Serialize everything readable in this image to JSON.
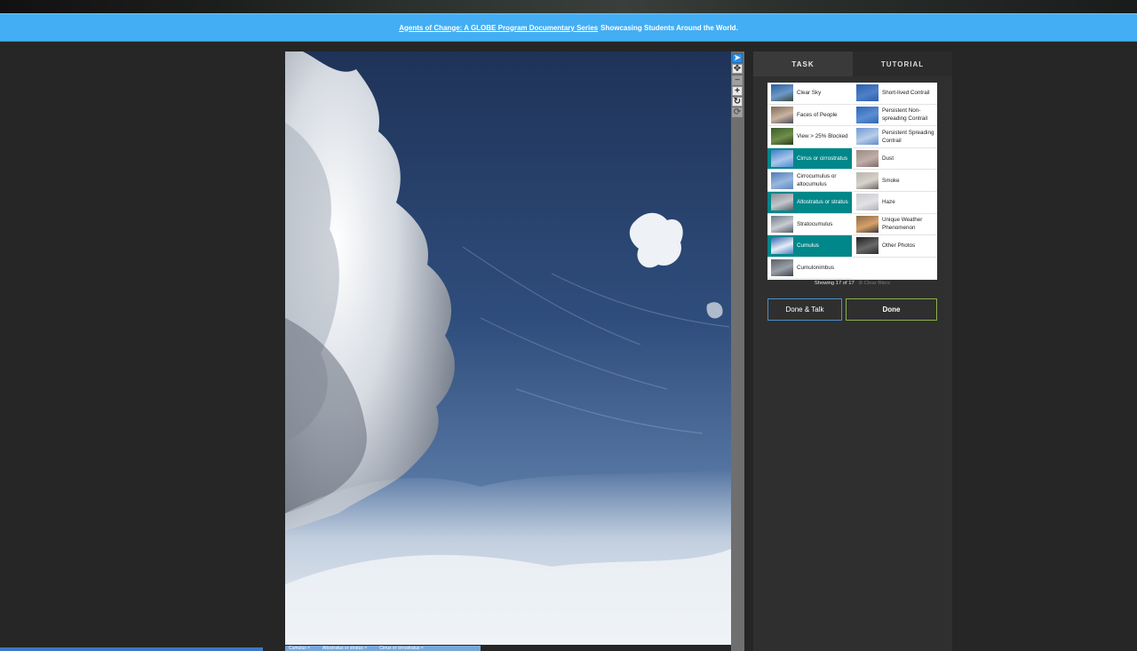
{
  "announcement": {
    "link_text": "Agents of Change: A GLOBE Program Documentary Series",
    "rest_text": "Showcasing Students Around the World."
  },
  "toolbar": {
    "tools": [
      {
        "name": "pointer",
        "glyph": "➤",
        "active": true
      },
      {
        "name": "pan",
        "glyph": "✥",
        "active": false
      },
      {
        "name": "zoom-out",
        "glyph": "−",
        "active": false,
        "disabled": true
      },
      {
        "name": "zoom-in",
        "glyph": "+",
        "active": false
      },
      {
        "name": "rotate",
        "glyph": "↻",
        "active": false
      },
      {
        "name": "reset",
        "glyph": "⟳",
        "active": false,
        "disabled": true
      }
    ]
  },
  "tabs": [
    {
      "label": "TASK",
      "active": true
    },
    {
      "label": "TUTORIAL",
      "active": false
    }
  ],
  "choices": [
    {
      "label": "Clear Sky",
      "selected": false,
      "thumb_colors": [
        "#2a5d9b",
        "#6d98c8",
        "#3a4a3a"
      ]
    },
    {
      "label": "Short-lived Contrail",
      "selected": false,
      "thumb_colors": [
        "#2b5fae",
        "#4f80c7",
        "#2b5fae"
      ]
    },
    {
      "label": "Faces of People",
      "selected": false,
      "thumb_colors": [
        "#7d6a5a",
        "#c9b3a0",
        "#4a4a5a"
      ]
    },
    {
      "label": "Persistent Non-spreading Contrail",
      "selected": false,
      "thumb_colors": [
        "#2f66b5",
        "#5c8ed2",
        "#2f66b5"
      ]
    },
    {
      "label": "View > 25% Blocked",
      "selected": false,
      "thumb_colors": [
        "#3c5a2c",
        "#6f8f4a",
        "#2c3c1c"
      ]
    },
    {
      "label": "Persistent Spreading Contrail",
      "selected": false,
      "thumb_colors": [
        "#6f9ad6",
        "#b8cde8",
        "#5d8ccb"
      ]
    },
    {
      "label": "Cirrus or cirrostratus",
      "selected": true,
      "thumb_colors": [
        "#3f7ec9",
        "#a9c7ea",
        "#4d8bd4"
      ]
    },
    {
      "label": "Dust",
      "selected": false,
      "thumb_colors": [
        "#9c8a86",
        "#c2aea8",
        "#7d6c6a"
      ]
    },
    {
      "label": "Cirrocumulus or altocumulus",
      "selected": false,
      "thumb_colors": [
        "#4d7cb8",
        "#9ab8dc",
        "#5d88c0"
      ]
    },
    {
      "label": "Smoke",
      "selected": false,
      "thumb_colors": [
        "#b9b4ae",
        "#d7d2cc",
        "#6b6660"
      ]
    },
    {
      "label": "Altostratus or stratus",
      "selected": true,
      "thumb_colors": [
        "#8a8f96",
        "#c3c7cc",
        "#5a5f66"
      ]
    },
    {
      "label": "Haze",
      "selected": false,
      "thumb_colors": [
        "#c9c9cf",
        "#e1e1e6",
        "#b0b0b8"
      ]
    },
    {
      "label": "Stratocumulus",
      "selected": false,
      "thumb_colors": [
        "#6a7a8c",
        "#c8ccd0",
        "#505a66"
      ]
    },
    {
      "label": "Unique Weather Phenomenon",
      "selected": false,
      "thumb_colors": [
        "#8a6a4a",
        "#d9a06a",
        "#3a3a3a"
      ]
    },
    {
      "label": "Cumulus",
      "selected": true,
      "thumb_colors": [
        "#2f62b0",
        "#e6edf5",
        "#4a7fc6"
      ]
    },
    {
      "label": "Other Photos",
      "selected": false,
      "thumb_colors": [
        "#1e1e1e",
        "#6a6a6a",
        "#2c2c2c"
      ]
    },
    {
      "label": "Cumulonimbus",
      "selected": false,
      "thumb_colors": [
        "#5a5f66",
        "#9aa0a8",
        "#3e4248"
      ]
    }
  ],
  "showing": {
    "text": "Showing 17 of 17",
    "clear_label": "⊘ Clear filters"
  },
  "buttons": {
    "done_talk": "Done & Talk",
    "done": "Done"
  },
  "bottom_tags": [
    "Cumulus ×",
    "Altostratus or stratus ×",
    "Cirrus or cirrostratus ×"
  ],
  "colors": {
    "accent_blue": "#43aef3",
    "selected_teal": "#00878a"
  }
}
